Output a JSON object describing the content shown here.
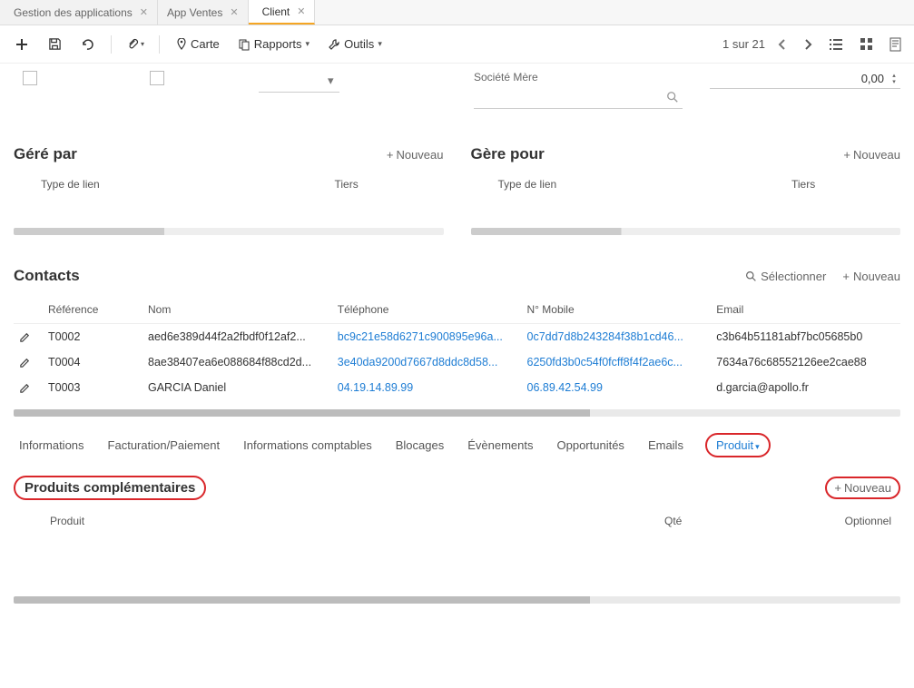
{
  "tabs": [
    {
      "label": "Gestion des applications"
    },
    {
      "label": "App Ventes"
    },
    {
      "label": "Client"
    }
  ],
  "toolbar": {
    "carte": "Carte",
    "rapports": "Rapports",
    "outils": "Outils",
    "pager": "1 sur 21"
  },
  "top": {
    "num_value": "0,00",
    "societe_mere_label": "Société Mère"
  },
  "gere_par": {
    "title": "Géré par",
    "nouveau": "Nouveau",
    "col1": "Type de lien",
    "col2": "Tiers"
  },
  "gere_pour": {
    "title": "Gère pour",
    "nouveau": "Nouveau",
    "col1": "Type de lien",
    "col2": "Tiers"
  },
  "contacts": {
    "title": "Contacts",
    "select": "Sélectionner",
    "nouveau": "Nouveau",
    "headers": {
      "ref": "Référence",
      "nom": "Nom",
      "tel": "Téléphone",
      "mob": "N° Mobile",
      "email": "Email"
    },
    "rows": [
      {
        "ref": "T0002",
        "nom": "aed6e389d44f2a2fbdf0f12af2...",
        "tel": "bc9c21e58d6271c900895e96a...",
        "mob": "0c7dd7d8b243284f38b1cd46...",
        "email": "c3b64b51181abf7bc05685b0"
      },
      {
        "ref": "T0004",
        "nom": "8ae38407ea6e088684f88cd2d...",
        "tel": "3e40da9200d7667d8ddc8d58...",
        "mob": "6250fd3b0c54f0fcff8f4f2ae6c...",
        "email": "7634a76c68552126ee2cae88"
      },
      {
        "ref": "T0003",
        "nom": "GARCIA Daniel",
        "tel": "04.19.14.89.99",
        "mob": "06.89.42.54.99",
        "email": "d.garcia@apollo.fr"
      }
    ]
  },
  "subtabs": [
    "Informations",
    "Facturation/Paiement",
    "Informations comptables",
    "Blocages",
    "Évènements",
    "Opportunités",
    "Emails",
    "Produit"
  ],
  "products": {
    "title": "Produits complémentaires",
    "nouveau": "Nouveau",
    "headers": {
      "produit": "Produit",
      "qte": "Qté",
      "opt": "Optionnel"
    }
  }
}
